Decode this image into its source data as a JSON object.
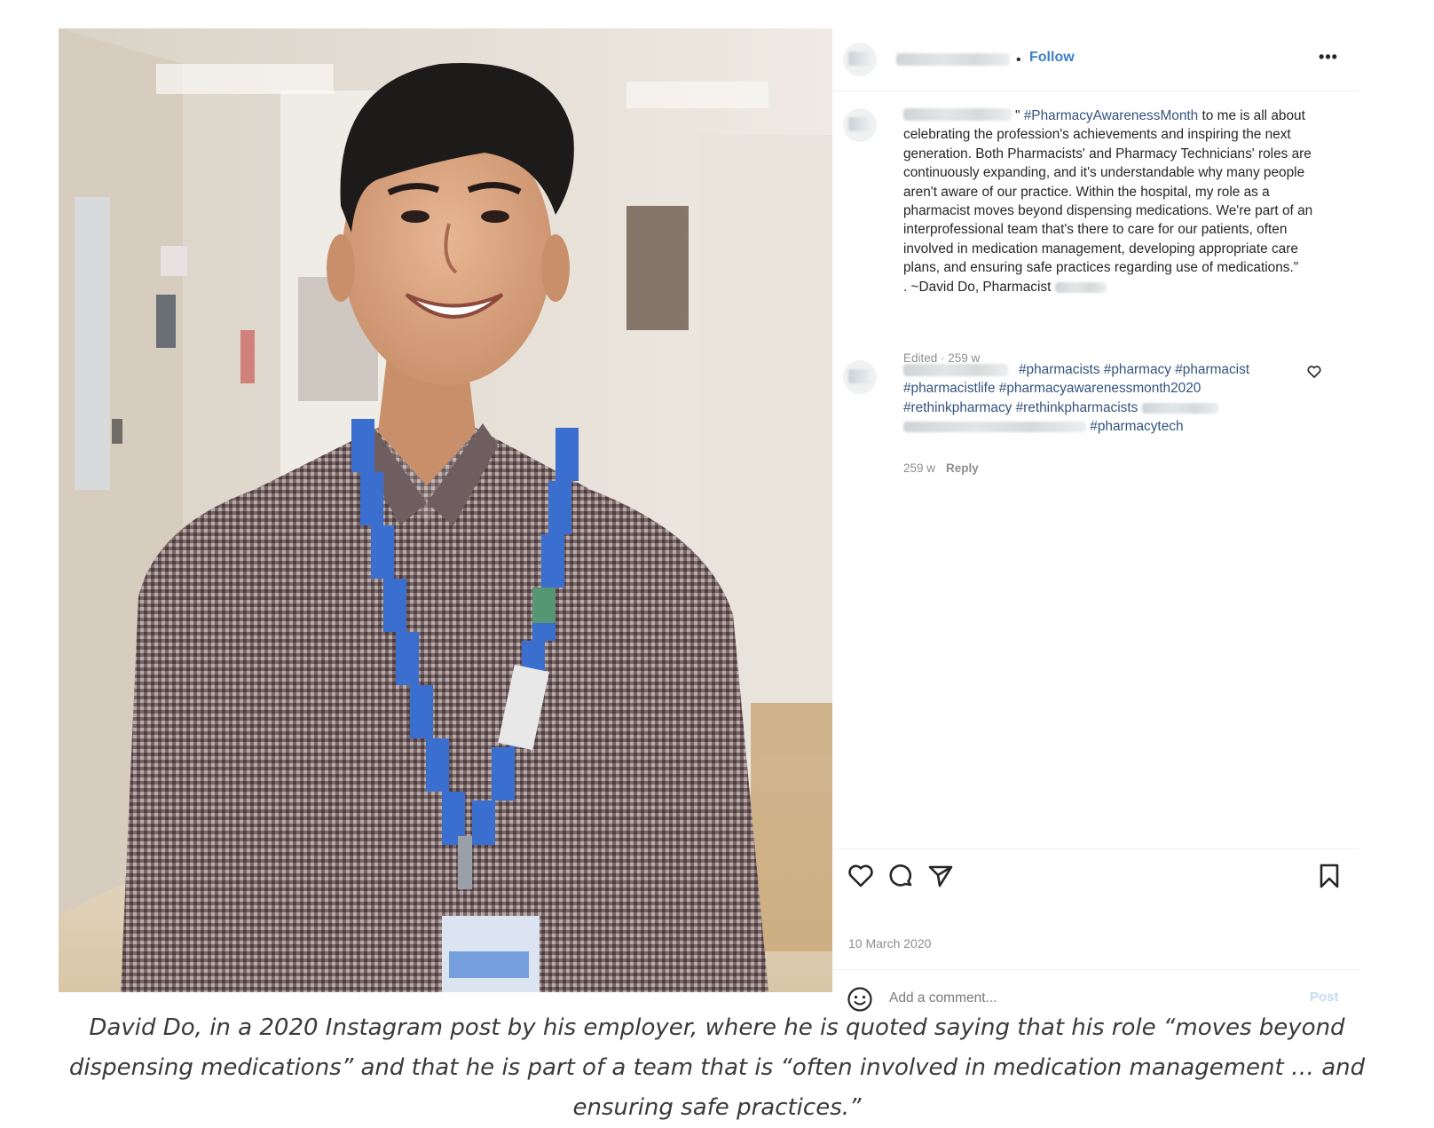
{
  "post": {
    "header": {
      "separator": "•",
      "follow_label": "Follow",
      "more_icon": "•••"
    },
    "caption": {
      "quote_open": "\"",
      "hashtag": "#PharmacyAwarenessMonth",
      "body": "to me is all about celebrating the profession's achievements and inspiring the next generation. Both Pharmacists' and Pharmacy Technicians' roles are continuously expanding, and it's understandable why many people aren't aware of our practice. Within the hospital, my role as a pharmacist moves beyond dispensing medications. We're part of an interprofessional team that's there to care for our patients, often involved in medication management, developing appropriate care plans, and ensuring safe practices regarding use of medications.\"",
      "signature": ". ~David Do, Pharmacist",
      "meta": "Edited · 259 w"
    },
    "comment": {
      "line1": "#pharmacists #pharmacy #pharmacist",
      "line2": "#pharmacistlife #pharmacyawarenessmonth2020",
      "line3": "#rethinkpharmacy #rethinkpharmacists",
      "line4": "#pharmacytech",
      "age": "259 w",
      "reply_label": "Reply"
    },
    "date": "10 March 2020",
    "composer": {
      "placeholder": "Add a comment...",
      "post_label": "Post"
    }
  },
  "icons": {
    "like": "heart-icon",
    "comment": "comment-icon",
    "share": "share-icon",
    "save": "bookmark-icon",
    "emoji": "emoji-icon",
    "more": "more-icon"
  },
  "colors": {
    "follow_blue": "#3b80c6",
    "hashtag_blue": "#34547f",
    "muted_gray": "#8e8e8e",
    "post_disabled": "#c3dcf5"
  },
  "article_caption": "David Do, in a 2020 Instagram post by his employer, where he is quoted saying that his role “moves beyond dispensing medications” and that he is part of a team that is “often involved in medication management … and ensuring safe practices.”"
}
